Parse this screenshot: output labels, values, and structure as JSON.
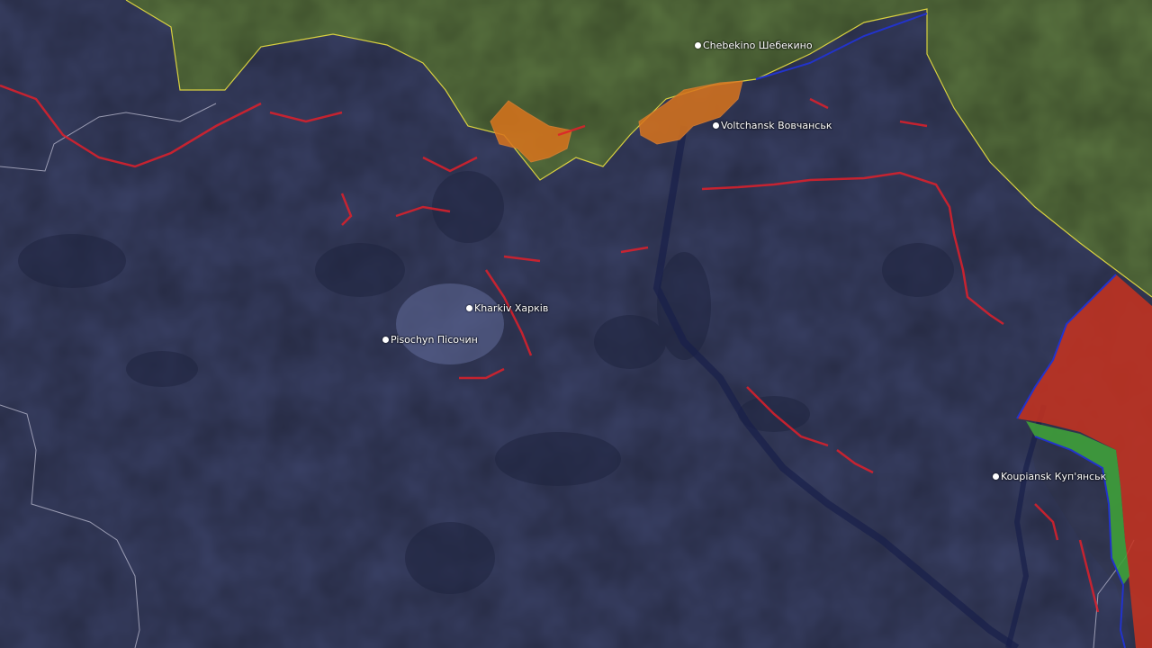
{
  "cities": [
    {
      "id": "chebekino",
      "label": "Chebekino Шебекино"
    },
    {
      "id": "voltchansk",
      "label": "Voltchansk Вовчанськ"
    },
    {
      "id": "kharkiv",
      "label": "Kharkiv Харків"
    },
    {
      "id": "pisochyn",
      "label": "Pisochyn Пісочин"
    },
    {
      "id": "koupiansk",
      "label": "Koupiansk Куп'янськ"
    }
  ],
  "colors": {
    "ukraine_overlay": "#3a4166",
    "russia_territory": "#5a7440",
    "occupied_red": "#c8321e",
    "contested_orange": "#d9741c",
    "liberated_green": "#3fa03a",
    "frontline_blue": "#2233cc",
    "fortification_red": "#e0202a",
    "border_yellow": "#d8d040",
    "admin_border_white": "#c8c8dc"
  }
}
